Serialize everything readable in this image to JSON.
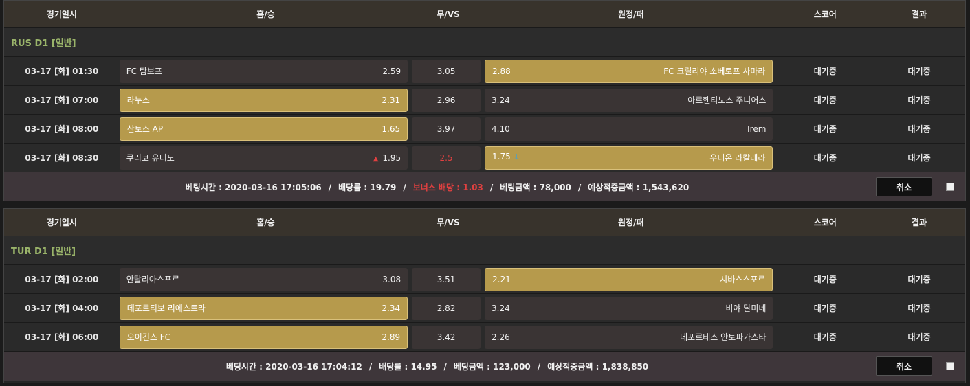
{
  "columns": {
    "time": "경기일시",
    "home": "홈/승",
    "draw": "무/VS",
    "away": "원정/패",
    "score": "스코어",
    "result": "결과"
  },
  "slips": [
    {
      "league": "RUS D1 [일반]",
      "matches": [
        {
          "time": "03-17 [화] 01:30",
          "home": "FC 탐보프",
          "home_odds": "2.59",
          "draw": "3.05",
          "away_odds": "2.88",
          "away": "FC 크릴리야 소베토프 사마라",
          "status": "대기중",
          "result": "대기중",
          "selected": "away"
        },
        {
          "time": "03-17 [화] 07:00",
          "home": "라누스",
          "home_odds": "2.31",
          "draw": "2.96",
          "away_odds": "3.24",
          "away": "아르헨티노스 주니어스",
          "status": "대기중",
          "result": "대기중",
          "selected": "home"
        },
        {
          "time": "03-17 [화] 08:00",
          "home": "산토스 AP",
          "home_odds": "1.65",
          "draw": "3.97",
          "away_odds": "4.10",
          "away": "Trem",
          "status": "대기중",
          "result": "대기중",
          "selected": "home"
        },
        {
          "time": "03-17 [화] 08:30",
          "home": "쿠리코 유니도",
          "home_odds": "1.95",
          "draw": "2.5",
          "away_odds": "1.75",
          "away": "우니온 라칼레라",
          "status": "대기중",
          "result": "대기중",
          "selected": "away",
          "home_trend": "up",
          "away_trend": "down",
          "draw_red": true
        }
      ],
      "footer": {
        "bet_time": "베팅시간 : 2020-03-16 17:05:06",
        "rate": "배당률 : 19.79",
        "bonus": "보너스 배당 : 1.03",
        "amount": "베팅금액 : 78,000",
        "expected": "예상적중금액 : 1,543,620",
        "cancel_label": "취소"
      }
    },
    {
      "league": "TUR D1 [일반]",
      "matches": [
        {
          "time": "03-17 [화] 02:00",
          "home": "안탈리아스포르",
          "home_odds": "3.08",
          "draw": "3.51",
          "away_odds": "2.21",
          "away": "시바스스포르",
          "status": "대기중",
          "result": "대기중",
          "selected": "away"
        },
        {
          "time": "03-17 [화] 04:00",
          "home": "데포르티보 리에스트라",
          "home_odds": "2.34",
          "draw": "2.82",
          "away_odds": "3.24",
          "away": "비야 달미네",
          "status": "대기중",
          "result": "대기중",
          "selected": "home"
        },
        {
          "time": "03-17 [화] 06:00",
          "home": "오이긴스 FC",
          "home_odds": "2.89",
          "draw": "3.42",
          "away_odds": "2.26",
          "away": "데포르테스 안토파가스타",
          "status": "대기중",
          "result": "대기중",
          "selected": "home"
        }
      ],
      "footer": {
        "bet_time": "베팅시간 : 2020-03-16 17:04:12",
        "rate": "배당률 : 14.95",
        "amount": "베팅금액 : 123,000",
        "expected": "예상적중금액 : 1,838,850",
        "cancel_label": "취소"
      }
    }
  ],
  "colors": {
    "selected_bg": "#b69a4c",
    "league_text": "#9ab46a",
    "red": "#e04040",
    "blue_arrow": "#3aa0e0"
  }
}
